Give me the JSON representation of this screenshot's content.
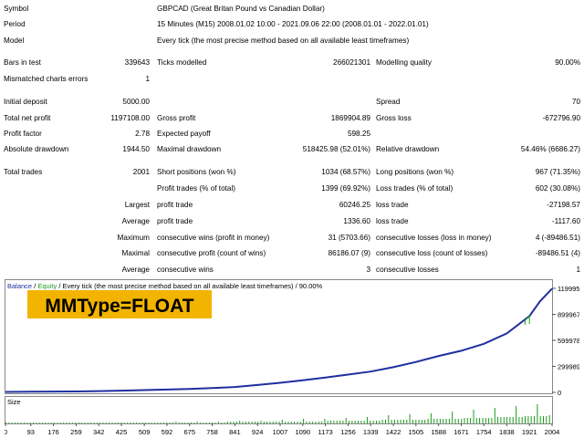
{
  "rows": {
    "symbol": {
      "label": "Symbol",
      "value": "GBPCAD (Great Britan Pound vs Canadian Dollar)"
    },
    "period": {
      "label": "Period",
      "value": "15 Minutes (M15) 2008.01.02 10:00 - 2021.09.06 22:00 (2008.01.01 - 2022.01.01)"
    },
    "model": {
      "label": "Model",
      "value": "Every tick (the most precise method based on all available least timeframes)"
    },
    "bars": {
      "label": "Bars in test",
      "value": "339643",
      "label2": "Ticks modelled",
      "value2": "266021301",
      "label3": "Modelling quality",
      "value3": "90.00%"
    },
    "mismatched": {
      "label": "Mismatched charts errors",
      "value": "1"
    },
    "deposit": {
      "label": "Initial deposit",
      "value": "5000.00",
      "label3": "Spread",
      "value3": "70"
    },
    "netprofit": {
      "label": "Total net profit",
      "value": "1197108.00",
      "label2": "Gross profit",
      "value2": "1869904.89",
      "label3": "Gross loss",
      "value3": "-672796.90"
    },
    "pf": {
      "label": "Profit factor",
      "value": "2.78",
      "label2": "Expected payoff",
      "value2": "598.25"
    },
    "absdd": {
      "label": "Absolute drawdown",
      "value": "1944.50",
      "label2": "Maximal drawdown",
      "value2": "518425.98 (52.01%)",
      "label3": "Relative drawdown",
      "value3": "54.46% (6686.27)"
    },
    "trades": {
      "label": "Total trades",
      "value": "2001",
      "label2": "Short positions (won %)",
      "value2": "1034 (68.57%)",
      "label3": "Long positions (won %)",
      "value3": "967 (71.35%)"
    },
    "ptrades": {
      "label2": "Profit trades (% of total)",
      "value2": "1399 (69.92%)",
      "label3": "Loss trades (% of total)",
      "value3": "602 (30.08%)"
    },
    "largest": {
      "label": "Largest",
      "label2": "profit trade",
      "value2": "60246.25",
      "label3": "loss trade",
      "value3": "-27198.57"
    },
    "average": {
      "label": "Average",
      "label2": "profit trade",
      "value2": "1336.60",
      "label3": "loss trade",
      "value3": "-1117.60"
    },
    "maximum": {
      "label": "Maximum",
      "label2": "consecutive wins (profit in money)",
      "value2": "31 (5703.66)",
      "label3": "consecutive losses (loss in money)",
      "value3": "4 (-89486.51)"
    },
    "maximal": {
      "label": "Maximal",
      "label2": "consecutive profit (count of wins)",
      "value2": "86186.07 (9)",
      "label3": "consecutive loss (count of losses)",
      "value3": "-89486.51 (4)"
    },
    "average2": {
      "label": "Average",
      "label2": "consecutive wins",
      "value2": "3",
      "label3": "consecutive losses",
      "value3": "1"
    }
  },
  "chart": {
    "legend_balance": "Balance",
    "legend_sep1": " / ",
    "legend_equity": "Equity",
    "legend_rest": " / Every tick (the most precise method based on all available least timeframes) / 90.00%",
    "badge": "MMType=FLOAT",
    "size_label": "Size",
    "y_ticks": [
      "1199956",
      "899967",
      "599978",
      "299989",
      "0"
    ],
    "x_ticks": [
      "0",
      "93",
      "176",
      "259",
      "342",
      "425",
      "509",
      "592",
      "675",
      "758",
      "841",
      "924",
      "1007",
      "1090",
      "1173",
      "1256",
      "1339",
      "1422",
      "1505",
      "1588",
      "1671",
      "1754",
      "1838",
      "1921",
      "2004"
    ]
  },
  "chart_data": {
    "type": "line",
    "series": [
      {
        "name": "Balance",
        "color": "#1f2f9f",
        "x": [
          0,
          93,
          176,
          259,
          342,
          425,
          509,
          592,
          675,
          758,
          841,
          924,
          1007,
          1090,
          1173,
          1256,
          1339,
          1422,
          1505,
          1588,
          1671,
          1754,
          1838,
          1921,
          1960,
          2004
        ],
        "values": [
          5000,
          7000,
          9000,
          11000,
          15000,
          20000,
          26000,
          33000,
          40000,
          50000,
          62000,
          85000,
          110000,
          140000,
          170000,
          205000,
          240000,
          290000,
          350000,
          420000,
          480000,
          560000,
          680000,
          880000,
          1050000,
          1197108
        ]
      },
      {
        "name": "Equity",
        "color": "#1d9b1d"
      }
    ],
    "ylim": [
      0,
      1199956
    ],
    "xlim": [
      0,
      2004
    ],
    "grid": false,
    "legend": "top-left"
  },
  "colors": {
    "balance": "#1f2f9f",
    "equity": "#1d9b1d",
    "badge_bg": "#f2b400",
    "axis": "#555555",
    "size_bars": "#1d9b1d"
  }
}
